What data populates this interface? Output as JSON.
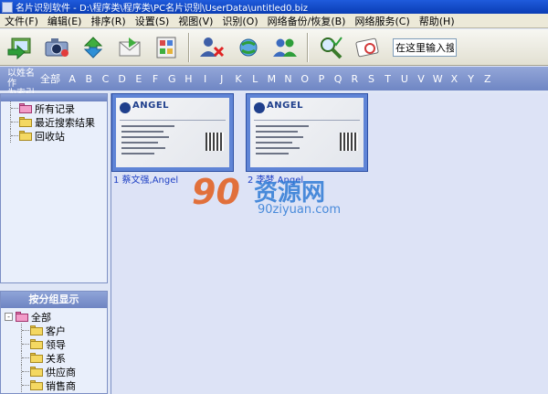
{
  "window": {
    "title": "名片识别软件 - D:\\程序类\\程序类\\PC名片识别\\UserData\\untitled0.biz"
  },
  "menu": {
    "items": [
      "文件(F)",
      "编辑(E)",
      "排序(R)",
      "设置(S)",
      "视图(V)",
      "识别(O)",
      "网络备份/恢复(B)",
      "网络服务(C)",
      "帮助(H)"
    ]
  },
  "toolbar": {
    "search_value": "在这里输入搜"
  },
  "letterbar": {
    "sort_label_line1": "以姓名作",
    "sort_label_line2": "为索引",
    "all": "全部",
    "letters": [
      "A",
      "B",
      "C",
      "D",
      "E",
      "F",
      "G",
      "H",
      "I",
      "J",
      "K",
      "L",
      "M",
      "N",
      "O",
      "P",
      "Q",
      "R",
      "S",
      "T",
      "U",
      "V",
      "W",
      "X",
      "Y",
      "Z"
    ]
  },
  "tree_top": {
    "items": [
      "所有记录",
      "最近搜索结果",
      "回收站"
    ]
  },
  "tree_bottom": {
    "header": "按分组显示",
    "root": "全部",
    "expander": "-",
    "children": [
      "客户",
      "领导",
      "关系",
      "供应商",
      "销售商"
    ]
  },
  "cards": [
    {
      "caption": "1 蔡文强,Angel",
      "logo": "ANGEL"
    },
    {
      "caption": "2 李梦,Angel",
      "logo": "ANGEL"
    }
  ],
  "watermark": {
    "logo": "90",
    "cn": "资源网",
    "url": "90ziyuan.com"
  }
}
